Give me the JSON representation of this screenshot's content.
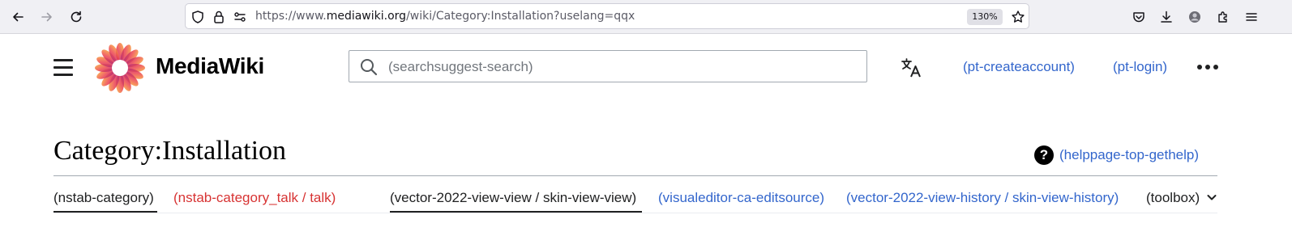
{
  "browser": {
    "url_prefix": "https://www.",
    "url_host": "mediawiki.org",
    "url_path": "/wiki/Category:Installation?uselang=qqx",
    "zoom": "130%"
  },
  "header": {
    "wordmark": "MediaWiki",
    "search_placeholder": "(searchsuggest-search)",
    "create_account": "(pt-createaccount)",
    "login": "(pt-login)"
  },
  "page": {
    "title": "Category:Installation",
    "help_link": "(helppage-top-gethelp)",
    "help_icon_glyph": "?"
  },
  "tabs": {
    "category": "(nstab-category)",
    "talk": "(nstab-category_talk / talk)",
    "view": "(vector-2022-view-view / skin-view-view)",
    "edit_source": "(visualeditor-ca-editsource)",
    "history": "(vector-2022-view-history / skin-view-history)",
    "toolbox": "(toolbox)"
  },
  "colors": {
    "link": "#3366cc",
    "new_link": "#d73333",
    "text": "#202122"
  }
}
